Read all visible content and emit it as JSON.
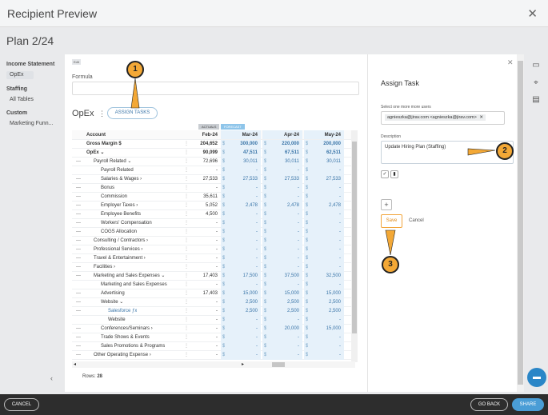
{
  "window": {
    "title": "Recipient Preview",
    "close_icon": "close-icon"
  },
  "plan_title": "Plan 2/24",
  "sidebar": {
    "sections": [
      {
        "label": "Income Statement",
        "items": [
          {
            "label": "OpEx",
            "active": true
          }
        ]
      },
      {
        "label": "Staffing",
        "items": [
          {
            "label": "All Tables",
            "active": false
          }
        ]
      },
      {
        "label": "Custom",
        "items": [
          {
            "label": "Marketing Funn...",
            "active": false
          }
        ]
      }
    ],
    "collapse_icon": "chevron-left-icon"
  },
  "editor": {
    "edit_tag": "Edit",
    "formula_label": "Formula",
    "sheet_title": "OpEx",
    "assign_label": "ASSIGN TASKS",
    "tag_actuals": "ACTUALS",
    "tag_forecast": "FORECAST",
    "rows_label": "Rows:",
    "rows_count": "28"
  },
  "table": {
    "headers": {
      "account": "Account",
      "feb": "Feb-24",
      "mar": "Mar-24",
      "apr": "Apr-24",
      "may": "May-24"
    },
    "rows": [
      {
        "dash": "",
        "account": "Gross Margin $",
        "indent": 0,
        "bold": true,
        "feb": "204,652",
        "mar": "300,000",
        "apr": "220,000",
        "may": "200,000",
        "dol": "$"
      },
      {
        "dash": "",
        "account": "OpEx  ⌄",
        "indent": 0,
        "bold": true,
        "feb": "90,099",
        "mar": "47,511",
        "apr": "67,511",
        "may": "62,511",
        "dol": "$"
      },
      {
        "dash": "—",
        "account": "Payroll Related  ⌄",
        "indent": 1,
        "bold": false,
        "feb": "72,696",
        "mar": "30,011",
        "apr": "30,011",
        "may": "30,011",
        "dol": "$"
      },
      {
        "dash": "",
        "account": "Payroll Related",
        "indent": 2,
        "bold": false,
        "feb": "-",
        "mar": "-",
        "apr": "-",
        "may": "-",
        "dol": "$"
      },
      {
        "dash": "—",
        "account": "Salaries & Wages  ›",
        "indent": 2,
        "bold": false,
        "feb": "27,533",
        "mar": "27,533",
        "apr": "27,533",
        "may": "27,533",
        "dol": "$"
      },
      {
        "dash": "—",
        "account": "Bonus",
        "indent": 2,
        "bold": false,
        "feb": "-",
        "mar": "-",
        "apr": "-",
        "may": "-",
        "dol": "$"
      },
      {
        "dash": "—",
        "account": "Commission",
        "indent": 2,
        "bold": false,
        "feb": "35,611",
        "mar": "-",
        "apr": "-",
        "may": "-",
        "dol": "$"
      },
      {
        "dash": "—",
        "account": "Employer Taxes  ›",
        "indent": 2,
        "bold": false,
        "feb": "5,052",
        "mar": "2,478",
        "apr": "2,478",
        "may": "2,478",
        "dol": "$"
      },
      {
        "dash": "—",
        "account": "Employee Benefits",
        "indent": 2,
        "bold": false,
        "feb": "4,500",
        "mar": "-",
        "apr": "-",
        "may": "-",
        "dol": "$"
      },
      {
        "dash": "—",
        "account": "Workers' Compensation",
        "indent": 2,
        "bold": false,
        "feb": "-",
        "mar": "-",
        "apr": "-",
        "may": "-",
        "dol": "$"
      },
      {
        "dash": "—",
        "account": "COGS Allocation",
        "indent": 2,
        "bold": false,
        "feb": "-",
        "mar": "-",
        "apr": "-",
        "may": "-",
        "dol": "$"
      },
      {
        "dash": "—",
        "account": "Consulting / Contractors  ›",
        "indent": 1,
        "bold": false,
        "feb": "-",
        "mar": "-",
        "apr": "-",
        "may": "-",
        "dol": "$"
      },
      {
        "dash": "—",
        "account": "Professional Services  ›",
        "indent": 1,
        "bold": false,
        "feb": "-",
        "mar": "-",
        "apr": "-",
        "may": "-",
        "dol": "$"
      },
      {
        "dash": "—",
        "account": "Travel & Entertainment  ›",
        "indent": 1,
        "bold": false,
        "feb": "-",
        "mar": "-",
        "apr": "-",
        "may": "-",
        "dol": "$"
      },
      {
        "dash": "—",
        "account": "Facilities  ›",
        "indent": 1,
        "bold": false,
        "feb": "-",
        "mar": "-",
        "apr": "-",
        "may": "-",
        "dol": "$"
      },
      {
        "dash": "—",
        "account": "Marketing and Sales Expenses  ⌄",
        "indent": 1,
        "bold": false,
        "feb": "17,403",
        "mar": "17,500",
        "apr": "37,500",
        "may": "32,500",
        "dol": "$"
      },
      {
        "dash": "",
        "account": "Marketing and Sales Expenses",
        "indent": 2,
        "bold": false,
        "feb": "-",
        "mar": "-",
        "apr": "-",
        "may": "-",
        "dol": "$"
      },
      {
        "dash": "—",
        "account": "Advertising",
        "indent": 2,
        "bold": false,
        "feb": "17,403",
        "mar": "15,000",
        "apr": "15,000",
        "may": "15,000",
        "dol": "$"
      },
      {
        "dash": "—",
        "account": "Website  ⌄",
        "indent": 2,
        "bold": false,
        "feb": "-",
        "mar": "2,500",
        "apr": "2,500",
        "may": "2,500",
        "dol": "$"
      },
      {
        "dash": "—",
        "account": "Salesforce  ƒx",
        "indent": 3,
        "bold": false,
        "link": true,
        "feb": "-",
        "mar": "2,500",
        "apr": "2,500",
        "may": "2,500",
        "dol": "$"
      },
      {
        "dash": "",
        "account": "Website",
        "indent": 3,
        "bold": false,
        "feb": "-",
        "mar": "-",
        "apr": "-",
        "may": "-",
        "dol": "$"
      },
      {
        "dash": "—",
        "account": "Conferences/Seminars  ›",
        "indent": 2,
        "bold": false,
        "feb": "-",
        "mar": "-",
        "apr": "20,000",
        "may": "15,000",
        "dol": "$"
      },
      {
        "dash": "—",
        "account": "Trade Shows & Events",
        "indent": 2,
        "bold": false,
        "feb": "-",
        "mar": "-",
        "apr": "-",
        "may": "-",
        "dol": "$"
      },
      {
        "dash": "—",
        "account": "Sales Promotions & Programs",
        "indent": 2,
        "bold": false,
        "feb": "-",
        "mar": "-",
        "apr": "-",
        "may": "-",
        "dol": "$"
      },
      {
        "dash": "—",
        "account": "Other Operating Expense  ›",
        "indent": 1,
        "bold": false,
        "feb": "-",
        "mar": "-",
        "apr": "-",
        "may": "-",
        "dol": "$"
      }
    ]
  },
  "assign_panel": {
    "title": "Assign Task",
    "users_label": "Select one more more users",
    "user_chip": "agnieszka@jirav.com <agnieszka@jirav.com>",
    "chip_remove": "✕",
    "description_label": "Description",
    "description_value": "Update Hiring Plan (Staffing)",
    "add_label": "+",
    "save_label": "Save",
    "cancel_label": "Cancel"
  },
  "footer": {
    "cancel": "CANCEL",
    "go_back": "GO BACK",
    "share": "SHARE"
  },
  "callouts": [
    "1",
    "2",
    "3"
  ],
  "colors": {
    "accent": "#4a9dd6",
    "callout": "#f3a836",
    "forecast_bg": "#e6f1fa",
    "save": "#f2a53b"
  }
}
